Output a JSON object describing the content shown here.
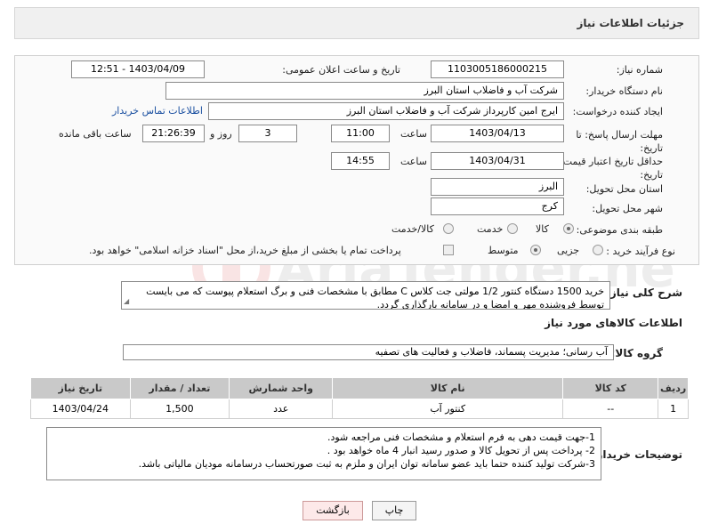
{
  "header": {
    "title": "جزئیات اطلاعات نیاز"
  },
  "form": {
    "need_number_label": "شماره نیاز:",
    "need_number": "1103005186000215",
    "announce_label": "تاریخ و ساعت اعلان عمومی:",
    "announce_value": "1403/04/09 - 12:51",
    "buyer_org_label": "نام دستگاه خریدار:",
    "buyer_org": "شرکت آب و فاضلاب استان البرز",
    "requester_label": "ایجاد کننده درخواست:",
    "requester": "ایرج امین کارپرداز شرکت آب و فاضلاب استان البرز",
    "contact_link": "اطلاعات تماس خریدار",
    "deadline_label": "مهلت ارسال پاسخ: تا تاریخ:",
    "deadline_date": "1403/04/13",
    "time_label": "ساعت",
    "deadline_time": "11:00",
    "days_value": "3",
    "days_label": "روز و",
    "remaining_time": "21:26:39",
    "remaining_label": "ساعت باقی مانده",
    "validity_label": "حداقل تاریخ اعتبار قیمت: تا تاریخ:",
    "validity_date": "1403/04/31",
    "validity_time": "14:55",
    "province_label": "استان محل تحویل:",
    "province": "البرز",
    "city_label": "شهر محل تحویل:",
    "city": "کرج",
    "category_label": "طبقه بندی موضوعی:",
    "category_options": [
      "کالا",
      "خدمت",
      "کالا/خدمت"
    ],
    "process_label": "نوع فرآیند خرید :",
    "process_options": [
      "جزیی",
      "متوسط"
    ],
    "payment_note": "پرداخت تمام یا بخشی از مبلغ خرید،از محل \"اسناد خزانه اسلامی\" خواهد بود."
  },
  "description": {
    "label": "شرح کلی نیاز:",
    "text": "خرید 1500 دستگاه کنتور 1/2 مولتی جت کلاس C مطابق با مشخصات فنی و برگ استعلام پیوست که می بایست توسط فروشنده مهر و امضا و در سامانه بارگذاری گردد."
  },
  "goods": {
    "section_title": "اطلاعات کالاهای مورد نیاز",
    "group_label": "گروه کالا:",
    "group_value": "آب رسانی؛ مدیریت پسماند، فاضلاب و فعالیت های تصفیه",
    "columns": [
      "ردیف",
      "کد کالا",
      "نام کالا",
      "واحد شمارش",
      "تعداد / مقدار",
      "تاریخ نیاز"
    ],
    "rows": [
      [
        "1",
        "--",
        "کنتور آب",
        "عدد",
        "1,500",
        "1403/04/24"
      ]
    ]
  },
  "buyer_notes": {
    "label": "توضیحات خریدار:",
    "lines": [
      "1-جهت قیمت دهی به فرم استعلام و مشخصات فنی مراجعه شود.",
      "2- پرداخت پس از تحویل کالا و صدور رسید انبار 4 ماه خواهد بود .",
      "3-شرکت تولید کننده حتما باید عضو سامانه توان ایران و ملزم به ثبت صورتحساب درسامانه مودیان مالیاتی باشد."
    ]
  },
  "buttons": {
    "print": "چاپ",
    "back": "بازگشت"
  },
  "watermark": "AriaTender.neT"
}
